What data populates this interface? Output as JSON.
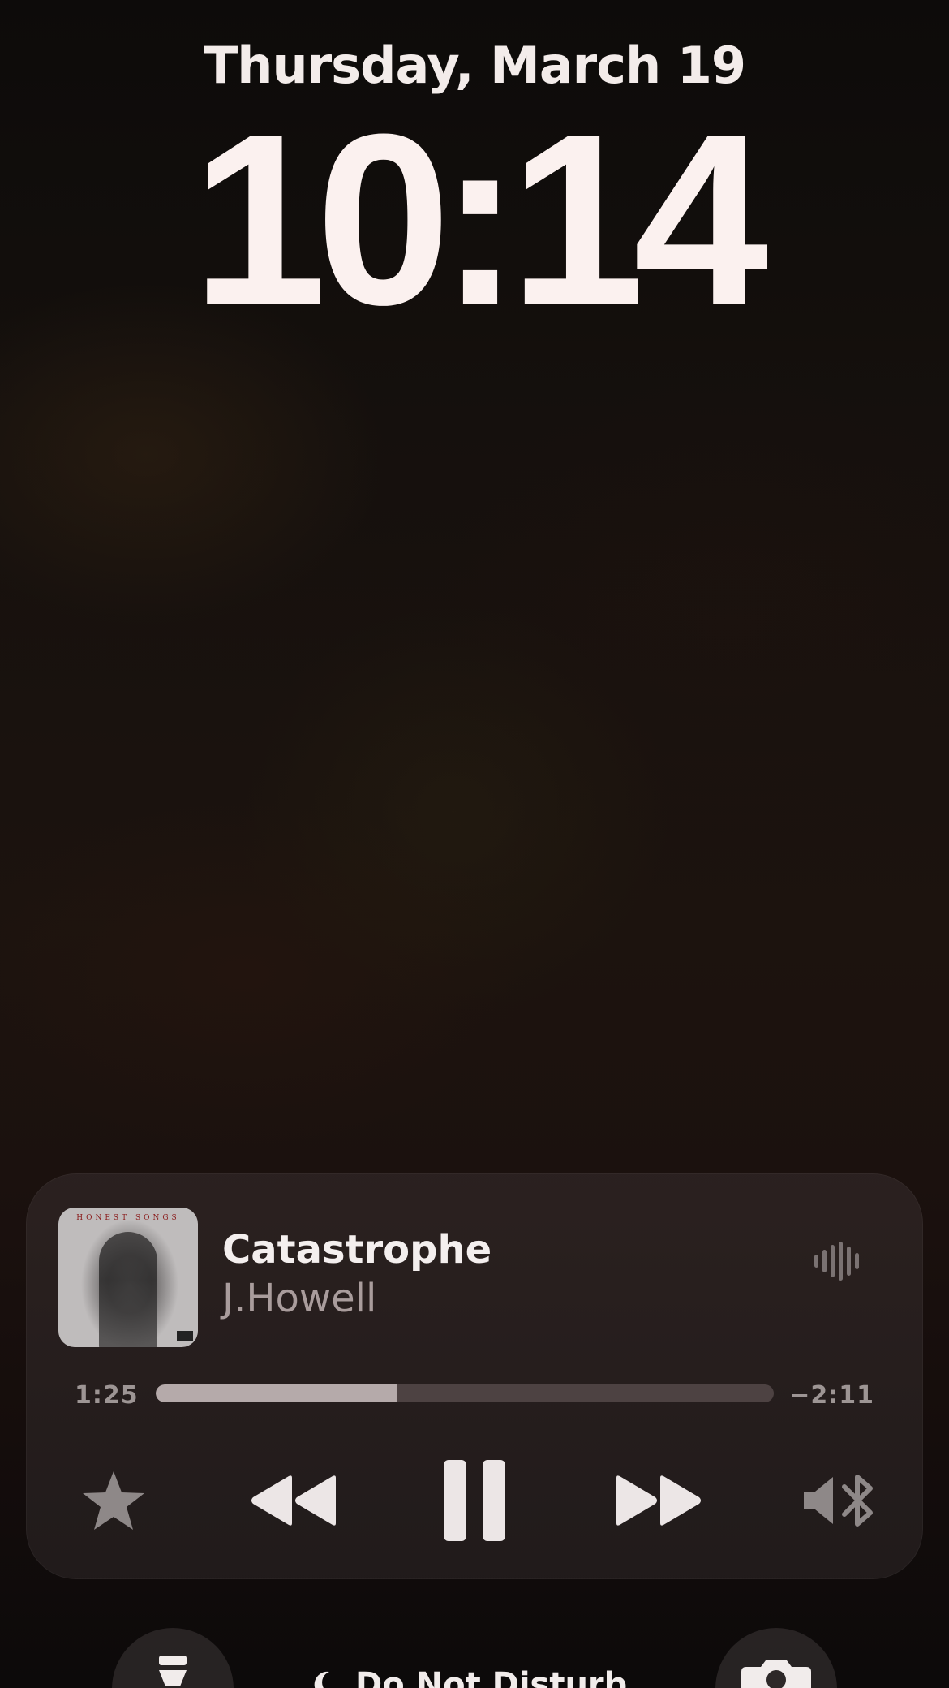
{
  "lockscreen": {
    "date": "Thursday, March 19",
    "time": "10:14"
  },
  "now_playing": {
    "title": "Catastrophe",
    "artist": "J.Howell",
    "elapsed": "1:25",
    "remaining": "−2:11",
    "progress_fraction": 0.39,
    "artwork_text": "HONEST SONGS",
    "icons": {
      "waveform": "waveform-icon",
      "favorite": "star-icon",
      "previous": "rewind-icon",
      "play_pause": "pause-icon",
      "next": "fast-forward-icon",
      "output": "speaker-bluetooth-icon"
    },
    "colors": {
      "progress_fill": "#b5aaaa",
      "progress_track": "#4d4242",
      "controls": "#ece6e6",
      "muted_controls": "#8e8888"
    }
  },
  "quick_actions": {
    "focus_label": "Do Not Disturb",
    "left_icon": "flashlight-icon",
    "right_icon": "camera-icon",
    "focus_icon": "moon-icon"
  }
}
